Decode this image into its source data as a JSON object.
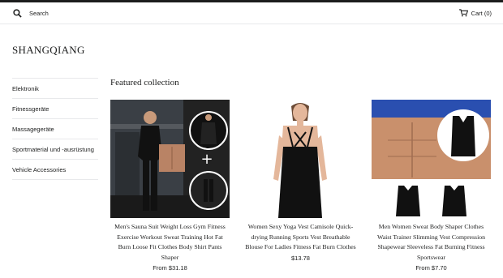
{
  "header": {
    "search_label": "Search",
    "cart_label": "Cart (0)"
  },
  "store": {
    "name": "SHANGQIANG"
  },
  "sidebar": {
    "items": [
      {
        "label": "Elektronik"
      },
      {
        "label": "Fitnessgeräte"
      },
      {
        "label": "Massagegeräte"
      },
      {
        "label": "Sportmaterial und -ausrüstung"
      },
      {
        "label": "Vehicle Accessories"
      }
    ]
  },
  "collection": {
    "heading": "Featured collection",
    "products": [
      {
        "title": "Men's Sauna Suit Weight Loss Gym Fitness Exercise Workout Sweat Training Hot Fat Burn Loose Fit Clothes Body Shirt Pants Shaper",
        "price": "From $31.18"
      },
      {
        "title": "Women Sexy Yoga Vest Camisole Quick-drying Running Sports Vest Breathable Blouse For Ladies Fitness Fat Burn Clothes",
        "price": "$13.78"
      },
      {
        "title": "Men Women Sweat Body Shaper Clothes Waist Trainer Slimming Vest Compression Shapewear Sleeveless Fat Burning Fitness Sportswear",
        "price": "From $7.70"
      }
    ]
  },
  "colors": {
    "text": "#1c1d1d",
    "border": "#e8e9eb",
    "top_bar": "#1c1d1d"
  }
}
